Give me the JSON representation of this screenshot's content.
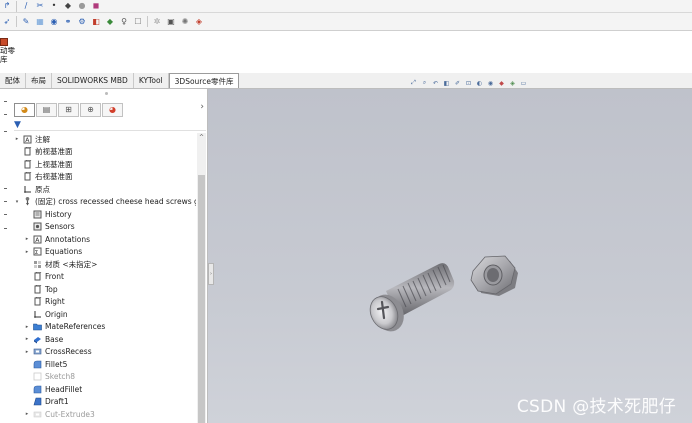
{
  "toolbar": {
    "row1_icons": [
      "sketch-arrow-icon",
      "line-icon",
      "trim-icon",
      "point-icon",
      "smart-dimension-icon",
      "circle-icon",
      "appearance-icon"
    ],
    "row2_icons": [
      "select-icon",
      "edit-icon",
      "grid-icon",
      "3d-sketch-icon",
      "mate-icon",
      "measure-icon",
      "component-icon",
      "assembly-icon",
      "light-icon",
      "view-icon",
      "hide-icon",
      "smart-fastener-icon",
      "render-icon",
      "3dsource-icon"
    ]
  },
  "ribbon": {
    "command": {
      "icon": "3dsource-library-icon",
      "label_line1": "动零",
      "label_line2": "库"
    }
  },
  "tabs": [
    {
      "label": "配体",
      "active": false
    },
    {
      "label": "布局",
      "active": false
    },
    {
      "label": "SOLIDWORKS MBD",
      "active": false
    },
    {
      "label": "KYTool",
      "active": false
    },
    {
      "label": "3DSource零件库",
      "active": true
    }
  ],
  "panel": {
    "tabs": [
      "feature-manager-icon",
      "property-manager-icon",
      "configuration-manager-icon",
      "dimxpert-icon",
      "display-manager-icon"
    ],
    "collapse_glyph": "›",
    "scroll_up_glyph": "^",
    "filter_glyph": "▼"
  },
  "tree": [
    {
      "label": "注解",
      "icon": "annotations-icon",
      "indent": 0,
      "expander": "▸",
      "muted": false
    },
    {
      "label": "前视基准面",
      "icon": "plane-icon",
      "indent": 0,
      "expander": "",
      "muted": false
    },
    {
      "label": "上视基准面",
      "icon": "plane-icon",
      "indent": 0,
      "expander": "",
      "muted": false
    },
    {
      "label": "右视基准面",
      "icon": "plane-icon",
      "indent": 0,
      "expander": "",
      "muted": false
    },
    {
      "label": "原点",
      "icon": "origin-icon",
      "indent": 0,
      "expander": "",
      "muted": false
    },
    {
      "label": "(固定) cross recessed cheese head screws g",
      "icon": "part-icon",
      "indent": 0,
      "expander": "▾",
      "muted": false
    },
    {
      "label": "History",
      "icon": "history-icon",
      "indent": 1,
      "expander": "",
      "muted": false
    },
    {
      "label": "Sensors",
      "icon": "sensors-icon",
      "indent": 1,
      "expander": "",
      "muted": false
    },
    {
      "label": "Annotations",
      "icon": "annotations-icon",
      "indent": 1,
      "expander": "▸",
      "muted": false
    },
    {
      "label": "Equations",
      "icon": "equations-icon",
      "indent": 1,
      "expander": "▸",
      "muted": false
    },
    {
      "label": "材质 <未指定>",
      "icon": "material-icon",
      "indent": 1,
      "expander": "",
      "muted": false
    },
    {
      "label": "Front",
      "icon": "plane-icon",
      "indent": 1,
      "expander": "",
      "muted": false
    },
    {
      "label": "Top",
      "icon": "plane-icon",
      "indent": 1,
      "expander": "",
      "muted": false
    },
    {
      "label": "Right",
      "icon": "plane-icon",
      "indent": 1,
      "expander": "",
      "muted": false
    },
    {
      "label": "Origin",
      "icon": "origin-icon",
      "indent": 1,
      "expander": "",
      "muted": false
    },
    {
      "label": "MateReferences",
      "icon": "folder-icon",
      "indent": 1,
      "expander": "▸",
      "muted": false
    },
    {
      "label": "Base",
      "icon": "extrude-icon",
      "indent": 1,
      "expander": "▸",
      "muted": false
    },
    {
      "label": "CrossRecess",
      "icon": "cut-icon",
      "indent": 1,
      "expander": "▸",
      "muted": false
    },
    {
      "label": "Fillet5",
      "icon": "fillet-icon",
      "indent": 1,
      "expander": "",
      "muted": false
    },
    {
      "label": "Sketch8",
      "icon": "sketch-icon",
      "indent": 1,
      "expander": "",
      "muted": true
    },
    {
      "label": "HeadFillet",
      "icon": "fillet-icon",
      "indent": 1,
      "expander": "",
      "muted": false
    },
    {
      "label": "Draft1",
      "icon": "draft-icon",
      "indent": 1,
      "expander": "",
      "muted": false
    },
    {
      "label": "Cut-Extrude3",
      "icon": "cut-extrude-icon",
      "indent": 1,
      "expander": "▸",
      "muted": true
    }
  ],
  "heads_up": [
    "zoom-fit-icon",
    "zoom-area-icon",
    "previous-view-icon",
    "section-view-icon",
    "dynamic-annotation-icon",
    "view-orientation-icon",
    "display-style-icon",
    "hide-show-icon",
    "edit-appearance-icon",
    "apply-scene-icon",
    "view-settings-icon"
  ],
  "colors": {
    "viewport_top": "#bfc2cb",
    "viewport_bottom": "#cfd2d9",
    "metal": "#8a8a8e"
  },
  "watermark": "CSDN @技术死肥仔"
}
